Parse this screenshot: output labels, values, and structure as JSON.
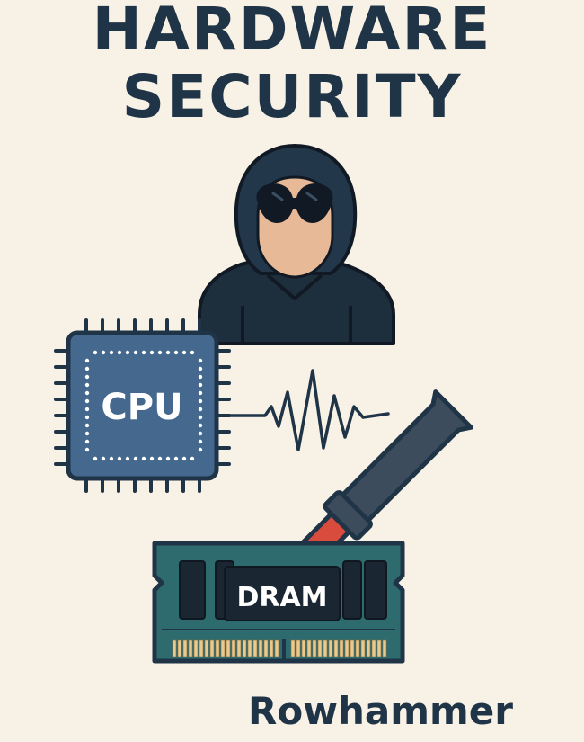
{
  "title": {
    "line1": "HARDWARE",
    "line2": "SECURITY"
  },
  "labels": {
    "cpu": "CPU",
    "dram": "DRAM"
  },
  "caption": "Rowhammer",
  "icons": [
    "hooded-hacker-icon",
    "cpu-chip-icon",
    "signal-wave-icon",
    "hammer-icon",
    "dram-module-icon"
  ],
  "colors": {
    "background": "#f8f1e6",
    "ink": "#1f3446",
    "cpu_blue": "#44688e",
    "dram_teal": "#2e6b6f",
    "hammer_red": "#d94b3d",
    "skin": "#e8b996",
    "gold_pins": "#e8c98f"
  }
}
